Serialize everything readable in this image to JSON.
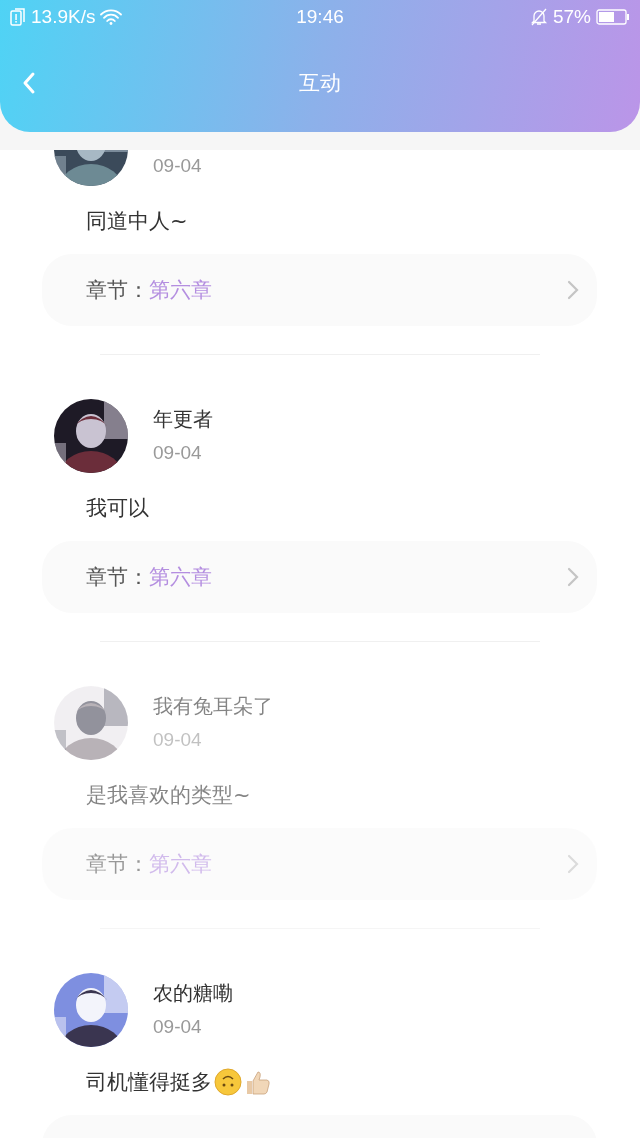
{
  "status_bar": {
    "speed": "13.9K/s",
    "time": "19:46",
    "battery": "57%"
  },
  "header": {
    "title": "互动"
  },
  "comments": [
    {
      "date": "09-04",
      "text": "同道中人~",
      "has_emoji": false,
      "chapter_label": "章节：",
      "chapter": "第六章",
      "faded": false
    },
    {
      "name": "年更者",
      "date": "09-04",
      "text": "我可以",
      "has_emoji": false,
      "chapter_label": "章节：",
      "chapter": "第六章",
      "faded": false
    },
    {
      "name": "我有兔耳朵了",
      "date": "09-04",
      "text": "是我喜欢的类型~",
      "has_emoji": false,
      "chapter_label": "章节：",
      "chapter": "第六章",
      "faded": true
    },
    {
      "name": "农的糖嘞",
      "date": "09-04",
      "text": "司机懂得挺多",
      "has_emoji": true,
      "faded": false
    }
  ]
}
